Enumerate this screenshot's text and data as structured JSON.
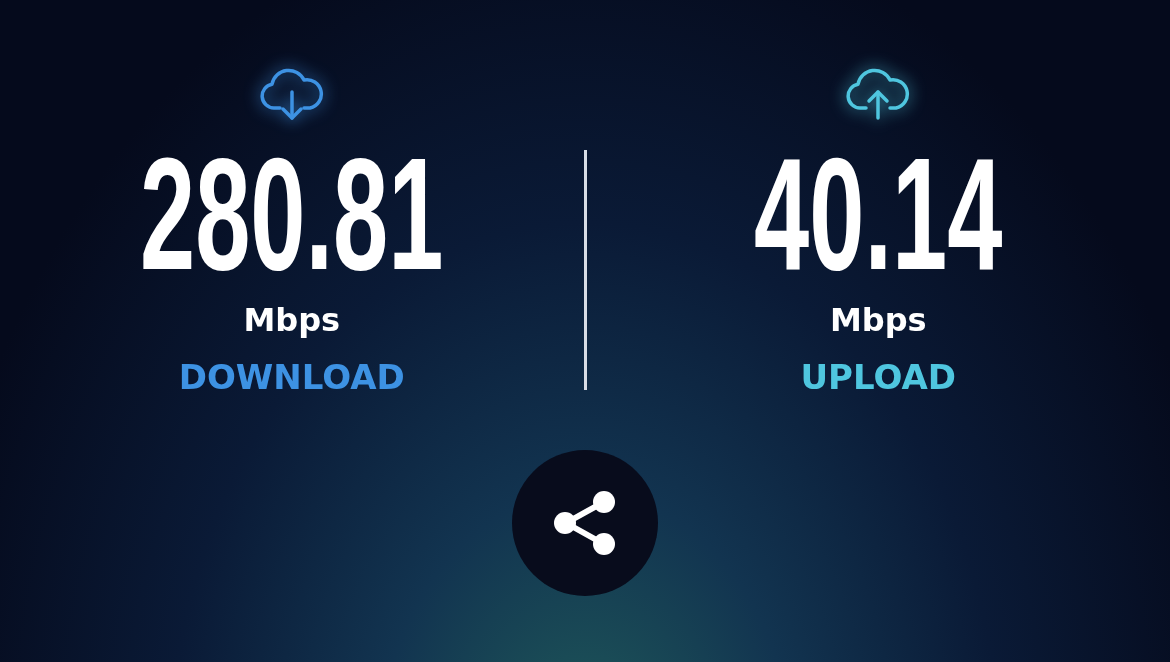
{
  "results": [
    {
      "kind": "download",
      "value": "280.81",
      "unit": "Mbps",
      "label": "DOWNLOAD",
      "color": "#3d92e3"
    },
    {
      "kind": "upload",
      "value": "40.14",
      "unit": "Mbps",
      "label": "UPLOAD",
      "color": "#4fc6df"
    }
  ]
}
